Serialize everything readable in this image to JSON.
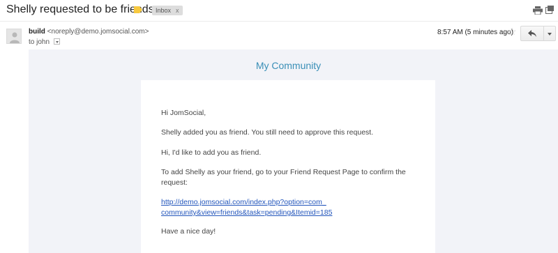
{
  "subject": {
    "title": "Shelly requested to be friends.",
    "label_name": "Inbox",
    "label_remove": "x"
  },
  "header": {
    "sender_name": "build",
    "sender_email": "<noreply@demo.jomsocial.com>",
    "recipient_prefix": "to",
    "recipient": "john",
    "time": "8:57 AM (5 minutes ago)",
    "star": "☆"
  },
  "body": {
    "community_title": "My Community",
    "greeting": "Hi JomSocial,",
    "added_text": "Shelly added you as friend. You still need to approve this request.",
    "message": "Hi, I'd like to add you as friend.",
    "instruction": "To add Shelly as your friend, go to your Friend Request Page to confirm the request:",
    "link_line1": "http://demo.jomsocial.com/index.php?option=com_",
    "link_line2": "community&view=friends&task=pending&Itemid=185",
    "closing": "Have a nice day!"
  },
  "colors": {
    "accent": "#3a8fb7",
    "link": "#2255bb",
    "label_marker": "#f7c940",
    "body_bg": "#f2f3f8"
  },
  "icons": [
    "label-marker-icon",
    "print-icon",
    "new-window-icon",
    "avatar-icon",
    "star-icon",
    "reply-icon",
    "chevron-down-icon"
  ]
}
